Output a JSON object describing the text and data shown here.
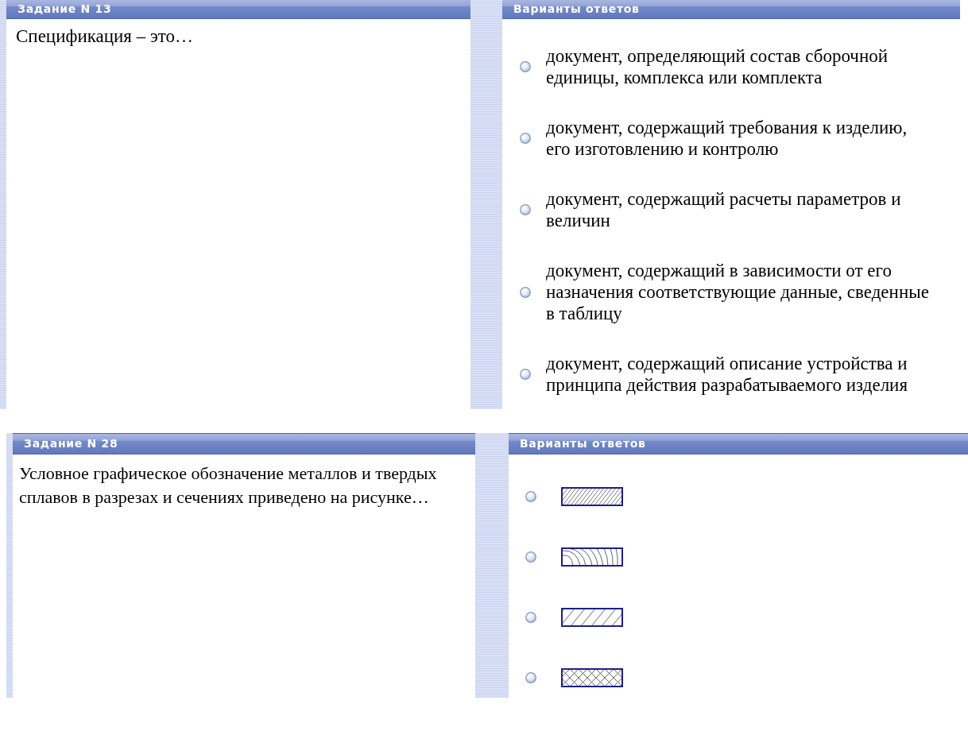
{
  "tasks": [
    {
      "header": "Задание N 13",
      "question": "Спецификация – это…",
      "answers_header": "Варианты ответов",
      "answers": [
        {
          "kind": "text",
          "text": "документ, определяющий состав сборочной единицы, комплекса или комплекта",
          "selected": false
        },
        {
          "kind": "text",
          "text": "документ, содержащий требования к изделию, его изготовлению и контролю",
          "selected": false
        },
        {
          "kind": "text",
          "text": "документ, содержащий расчеты параметров и величин",
          "selected": false
        },
        {
          "kind": "text",
          "text": "документ, содержащий в зависимости от его назначения соответствующие данные, сведенные в таблицу",
          "selected": false
        },
        {
          "kind": "text",
          "text": "документ, содержащий описание устройства и принципа действия разрабатываемого изделия",
          "selected": false
        }
      ]
    },
    {
      "header": "Задание N 28",
      "question": "Условное графическое обозначение металлов и твердых сплавов в разрезах и сечениях приведено на рисунке…",
      "answers_header": "Варианты ответов",
      "answers": [
        {
          "kind": "densehatch",
          "selected": false
        },
        {
          "kind": "woodgrain",
          "selected": false
        },
        {
          "kind": "hatch",
          "selected": false
        },
        {
          "kind": "crosshatch",
          "selected": false
        }
      ]
    }
  ]
}
